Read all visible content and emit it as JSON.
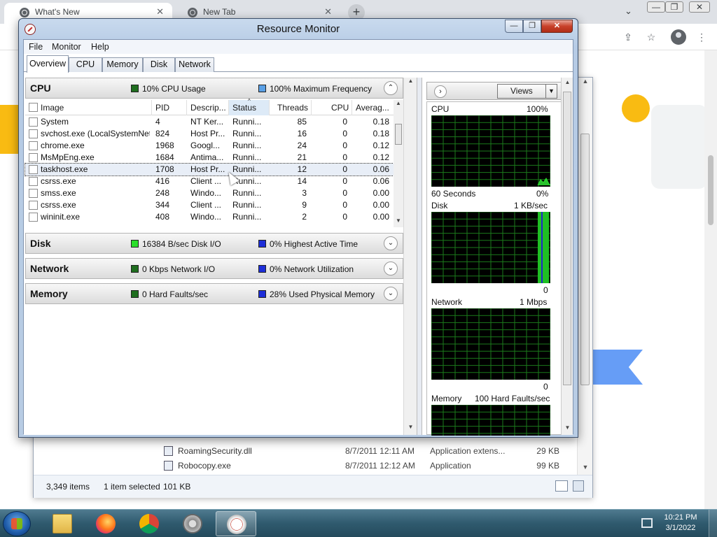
{
  "browser": {
    "tabs": [
      {
        "title": "What's New",
        "active": true
      },
      {
        "title": "New Tab",
        "active": false
      }
    ],
    "new_tab_symbol": "+",
    "controls": {
      "minimize": "—",
      "restore": "❐",
      "close": "✕"
    }
  },
  "explorer": {
    "files": [
      {
        "name": "RoamingSecurity.dll",
        "date": "8/7/2011 12:11 AM",
        "type": "Application extens...",
        "size": "29 KB"
      },
      {
        "name": "Robocopy.exe",
        "date": "8/7/2011 12:12 AM",
        "type": "Application",
        "size": "99 KB"
      }
    ],
    "status": {
      "items": "3,349 items",
      "selected": "1 item selected",
      "size": "101 KB"
    }
  },
  "resource_monitor": {
    "title": "Resource Monitor",
    "menu": [
      "File",
      "Monitor",
      "Help"
    ],
    "tabs": [
      "Overview",
      "CPU",
      "Memory",
      "Disk",
      "Network"
    ],
    "active_tab": "Overview",
    "cpu_section": {
      "title": "CPU",
      "usage": "10% CPU Usage",
      "frequency": "100% Maximum Frequency",
      "usage_color": "#1f9a2b",
      "frequency_color": "#5aa0e6"
    },
    "columns": [
      "Image",
      "PID",
      "Descrip...",
      "Status",
      "Threads",
      "CPU",
      "Averag..."
    ],
    "sorted_column": "Status",
    "processes": [
      {
        "image": "System",
        "pid": "4",
        "desc": "NT Ker...",
        "status": "Runni...",
        "threads": "85",
        "cpu": "0",
        "avg": "0.18"
      },
      {
        "image": "svchost.exe (LocalSystemNet...",
        "pid": "824",
        "desc": "Host Pr...",
        "status": "Runni...",
        "threads": "16",
        "cpu": "0",
        "avg": "0.18"
      },
      {
        "image": "chrome.exe",
        "pid": "1968",
        "desc": "Googl...",
        "status": "Runni...",
        "threads": "24",
        "cpu": "0",
        "avg": "0.12"
      },
      {
        "image": "MsMpEng.exe",
        "pid": "1684",
        "desc": "Antima...",
        "status": "Runni...",
        "threads": "21",
        "cpu": "0",
        "avg": "0.12"
      },
      {
        "image": "taskhost.exe",
        "pid": "1708",
        "desc": "Host Pr...",
        "status": "Runni...",
        "threads": "12",
        "cpu": "0",
        "avg": "0.06"
      },
      {
        "image": "csrss.exe",
        "pid": "416",
        "desc": "Client ...",
        "status": "Runni...",
        "threads": "14",
        "cpu": "0",
        "avg": "0.06"
      },
      {
        "image": "smss.exe",
        "pid": "248",
        "desc": "Windo...",
        "status": "Runni...",
        "threads": "3",
        "cpu": "0",
        "avg": "0.00"
      },
      {
        "image": "csrss.exe",
        "pid": "344",
        "desc": "Client ...",
        "status": "Runni...",
        "threads": "9",
        "cpu": "0",
        "avg": "0.00"
      },
      {
        "image": "wininit.exe",
        "pid": "408",
        "desc": "Windo...",
        "status": "Runni...",
        "threads": "2",
        "cpu": "0",
        "avg": "0.00"
      }
    ],
    "disk_section": {
      "title": "Disk",
      "io": "16384 B/sec Disk I/O",
      "active": "0% Highest Active Time"
    },
    "network_section": {
      "title": "Network",
      "io": "0 Kbps Network I/O",
      "util": "0% Network Utilization"
    },
    "memory_section": {
      "title": "Memory",
      "faults": "0 Hard Faults/sec",
      "used": "28% Used Physical Memory"
    },
    "right": {
      "views_label": "Views",
      "cpu_graph": {
        "label": "CPU",
        "max": "100%",
        "bottom_left": "60 Seconds",
        "bottom_right": "0%"
      },
      "disk_graph": {
        "label": "Disk",
        "max": "1 KB/sec",
        "bottom_right": "0"
      },
      "network_graph": {
        "label": "Network",
        "max": "1 Mbps",
        "bottom_right": "0"
      },
      "memory_graph": {
        "label": "Memory",
        "max": "100 Hard Faults/sec"
      }
    }
  },
  "taskbar": {
    "clock_time": "10:21 PM",
    "clock_date": "3/1/2022",
    "apps": [
      "explorer",
      "firefox",
      "chrome",
      "settings",
      "resource-monitor"
    ]
  }
}
